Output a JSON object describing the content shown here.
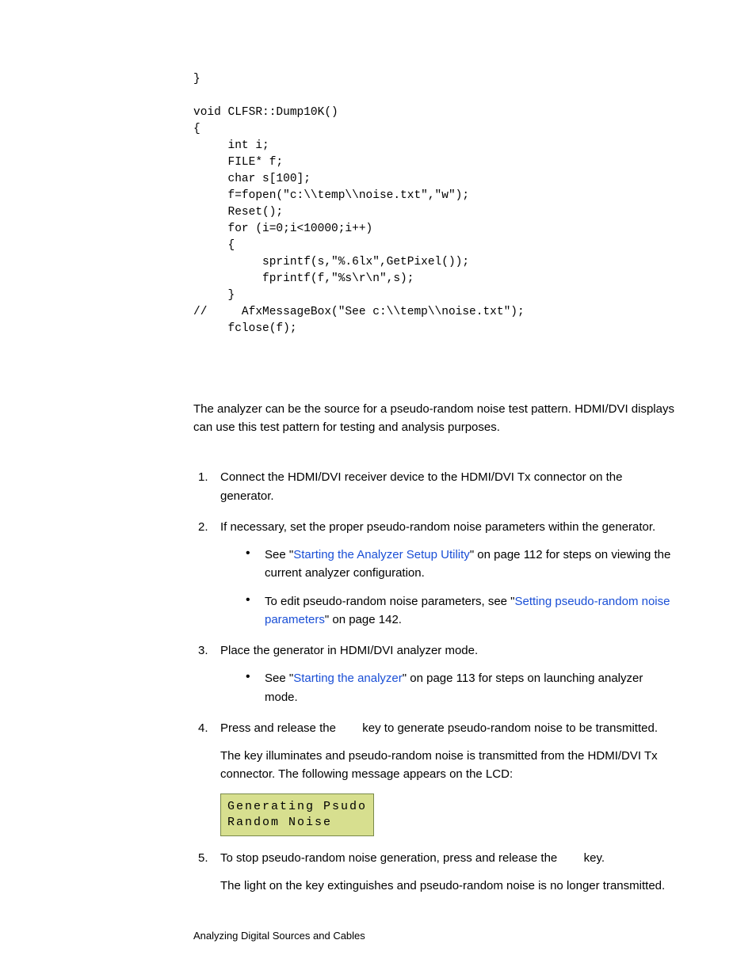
{
  "code": "}\n\nvoid CLFSR::Dump10K()\n{\n     int i;\n     FILE* f;\n     char s[100];\n     f=fopen(\"c:\\\\temp\\\\noise.txt\",\"w\");\n     Reset();\n     for (i=0;i<10000;i++)\n     {\n          sprintf(s,\"%.6lx\",GetPixel());\n          fprintf(f,\"%s\\r\\n\",s);\n     }\n//     AfxMessageBox(\"See c:\\\\temp\\\\noise.txt\");\n     fclose(f);",
  "intro": "The analyzer can be the source for a pseudo-random noise test pattern. HDMI/DVI displays can use this test pattern for testing and analysis purposes.",
  "steps": {
    "s1": "Connect the HDMI/DVI receiver device to the HDMI/DVI Tx connector on the generator.",
    "s2": "If necessary, set the proper pseudo-random noise parameters within the generator.",
    "s2a_pre": "See \"",
    "s2a_link": "Starting the Analyzer Setup Utility",
    "s2a_post": "\" on page 112 for steps on viewing the current analyzer configuration.",
    "s2b_pre": "To edit pseudo-random noise parameters, see \"",
    "s2b_link": "Setting pseudo-random noise parameters",
    "s2b_post": "\" on page 142.",
    "s3": "Place the generator in HDMI/DVI analyzer mode.",
    "s3a_pre": "See \"",
    "s3a_link": "Starting the analyzer",
    "s3a_post": "\" on page 113 for steps on launching analyzer mode.",
    "s4_pre": "Press and release the ",
    "s4_post": " key to generate pseudo-random noise to be transmitted.",
    "s4_after": "The key illuminates and pseudo-random noise is transmitted from the HDMI/DVI Tx connector. The following message appears on the LCD:",
    "lcd_l1": "Generating  Psudo",
    "lcd_l2": "Random Noise",
    "s5_pre": "To stop pseudo-random noise generation, press and release the ",
    "s5_post": " key.",
    "s5_after": "The light on the key extinguishes and pseudo-random noise is no longer transmitted."
  },
  "footer": "Analyzing Digital Sources and Cables"
}
